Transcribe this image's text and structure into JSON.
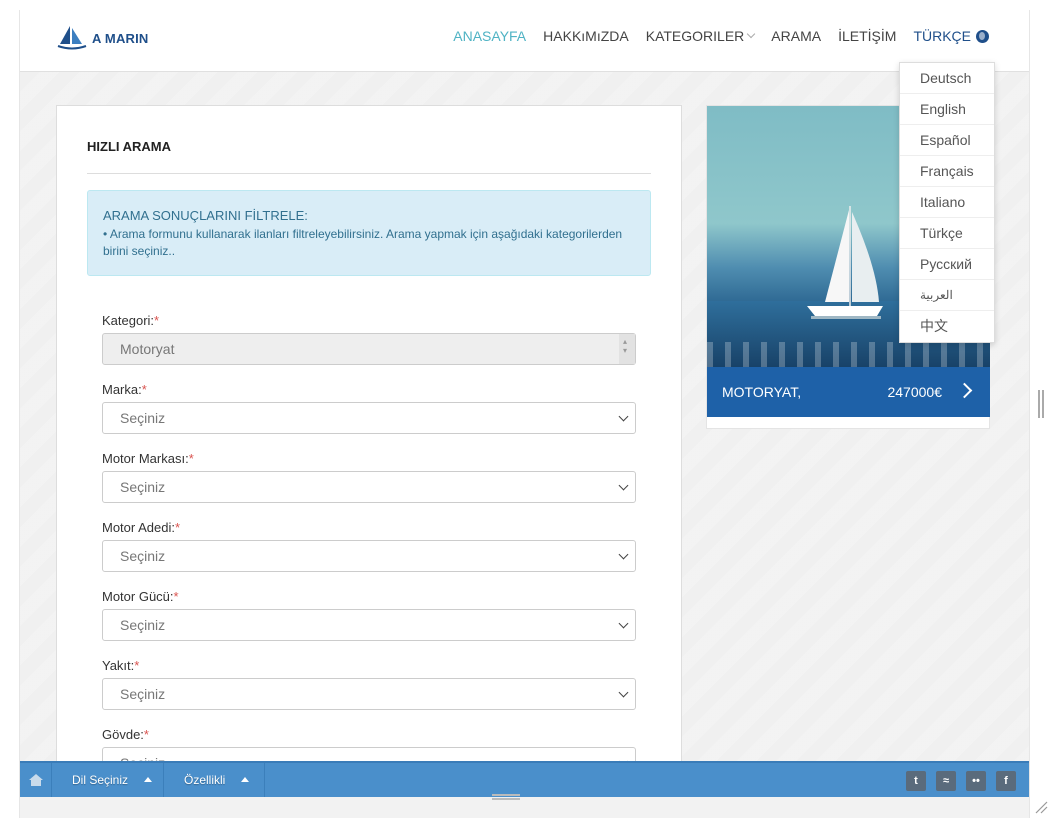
{
  "header": {
    "logo_text": "A MARIN",
    "nav": [
      {
        "label": "ANASAYFA",
        "active": true
      },
      {
        "label": "HAKKıMıZDA"
      },
      {
        "label": "KATEGORILER",
        "dropdown": true
      },
      {
        "label": "ARAMA"
      },
      {
        "label": "İLETİŞİM"
      },
      {
        "label": "TÜRKÇE",
        "icon": "globe-icon"
      }
    ],
    "accent_color": "#4fb3c4",
    "brand_color": "#1f4f8a"
  },
  "language_menu": [
    "Deutsch",
    "English",
    "Español",
    "Français",
    "Italiano",
    "Türkçe",
    "Русский",
    "العربية",
    "中文"
  ],
  "search": {
    "title": "HIZLI ARAMA",
    "info_title": "ARAMA SONUÇLARINI FİLTRELE:",
    "info_text": "• Arama formunu kullanarak ilanları filtreleyebilirsiniz. Arama yapmak için aşağıdaki kategorilerden birini seçiniz..",
    "fields": [
      {
        "label": "Kategori:",
        "required": "*",
        "value": "Motoryat"
      },
      {
        "label": "Marka:",
        "required": "*",
        "value": "Seçiniz"
      },
      {
        "label": "Motor Markası:",
        "required": "*",
        "value": "Seçiniz"
      },
      {
        "label": "Motor Adedi:",
        "required": "*",
        "value": "Seçiniz"
      },
      {
        "label": "Motor Gücü:",
        "required": "*",
        "value": "Seçiniz"
      },
      {
        "label": "Yakıt:",
        "required": "*",
        "value": "Seçiniz"
      },
      {
        "label": "Gövde:",
        "required": "*",
        "value": "Seçiniz"
      }
    ]
  },
  "listing": {
    "title": "MOTORYAT,",
    "price": "247000€"
  },
  "bottom_bar": {
    "home_icon": "home-icon",
    "language_label": "Dil Seçiniz",
    "features_label": "Özellikli",
    "social": [
      {
        "name": "twitter-icon",
        "glyph": "t"
      },
      {
        "name": "rss-icon",
        "glyph": "≈"
      },
      {
        "name": "flickr-icon",
        "glyph": "••"
      },
      {
        "name": "facebook-icon",
        "glyph": "f"
      }
    ]
  }
}
